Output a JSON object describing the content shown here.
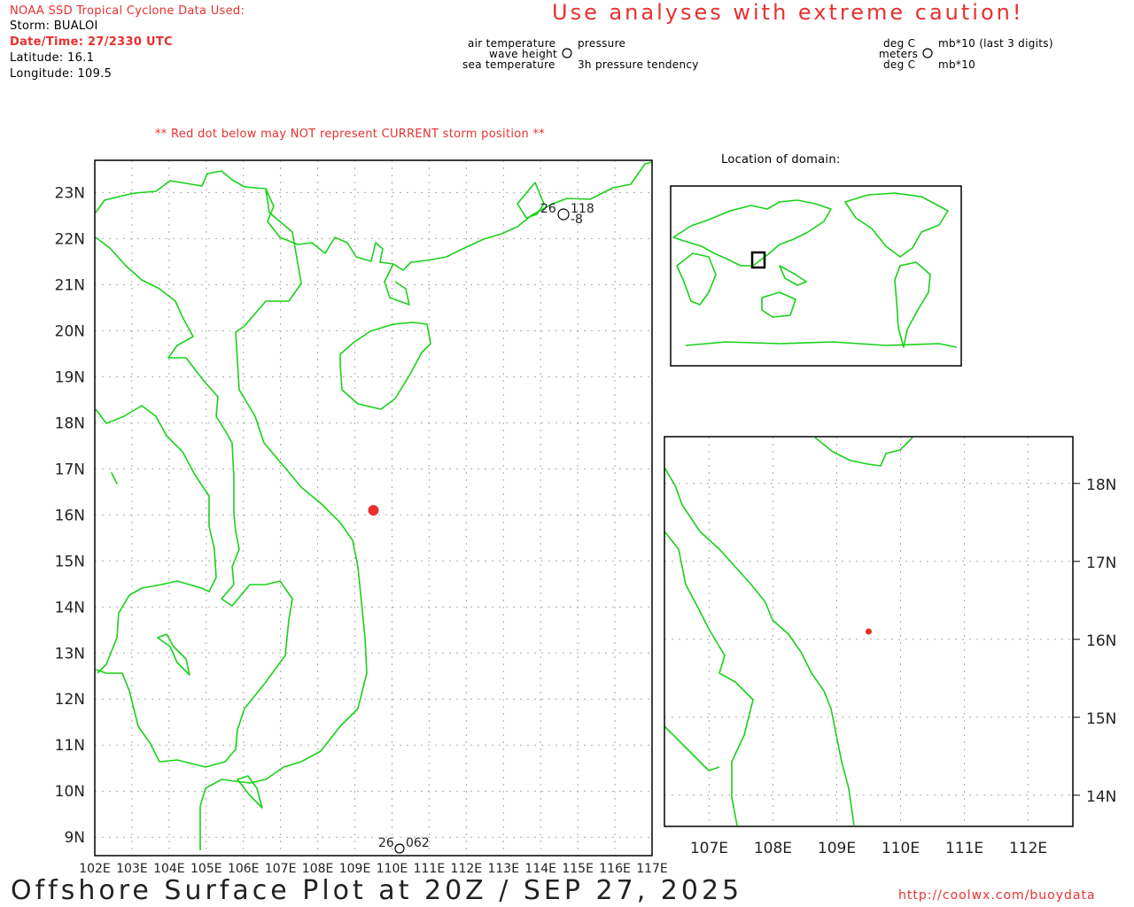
{
  "header": {
    "source": "NOAA SSD Tropical Cyclone Data Used:",
    "storm_label": "Storm: BUALOI",
    "datetime_label": "Date/Time: 27/2330 UTC",
    "latitude_label": "Latitude: 16.1",
    "longitude_label": "Longitude: 109.5"
  },
  "storm": {
    "name": "BUALOI",
    "lat": 16.1,
    "lon": 109.5,
    "time": "27/2330 UTC"
  },
  "caution": "Use analyses with extreme caution!",
  "legend_left": {
    "air_temp": "air temperature",
    "wave_height": "wave height",
    "sea_temp": "sea temperature",
    "pressure": "pressure",
    "tendency": "3h pressure tendency"
  },
  "legend_right": {
    "deg_c_1": "deg C",
    "meters": "meters",
    "deg_c_2": "deg C",
    "mb_digits": "mb*10 (last 3 digits)",
    "mb10": "mb*10"
  },
  "warning": "** Red dot below may NOT represent CURRENT storm position **",
  "location_label": "Location of domain:",
  "main_map": {
    "lon_range": [
      102,
      117
    ],
    "lat_range": [
      8.6,
      23.7
    ],
    "lon_ticks": [
      "102E",
      "103E",
      "104E",
      "105E",
      "106E",
      "107E",
      "108E",
      "109E",
      "110E",
      "111E",
      "112E",
      "113E",
      "114E",
      "115E",
      "116E",
      "117E"
    ],
    "lat_ticks": [
      "9N",
      "10N",
      "11N",
      "12N",
      "13N",
      "14N",
      "15N",
      "16N",
      "17N",
      "18N",
      "19N",
      "20N",
      "21N",
      "22N",
      "23N"
    ]
  },
  "zoom_map": {
    "lon_ticks": [
      "107E",
      "108E",
      "109E",
      "110E",
      "111E",
      "112E"
    ],
    "lat_ticks": [
      "14N",
      "15N",
      "16N",
      "17N",
      "18N"
    ]
  },
  "stations": [
    {
      "lat": 22.3,
      "lon": 114.5,
      "air_temp": "26",
      "pressure": "118",
      "tendency": "-8"
    },
    {
      "lat": 8.8,
      "lon": 110.1,
      "air_temp": "26",
      "pressure": "062"
    }
  ],
  "footer": {
    "title": "Offshore Surface Plot at 20Z / SEP 27, 2025",
    "url": "http://coolwx.com/buoydata"
  },
  "colors": {
    "coast": "#19d119",
    "storm": "#e8302f",
    "text_red": "#e8302f"
  }
}
